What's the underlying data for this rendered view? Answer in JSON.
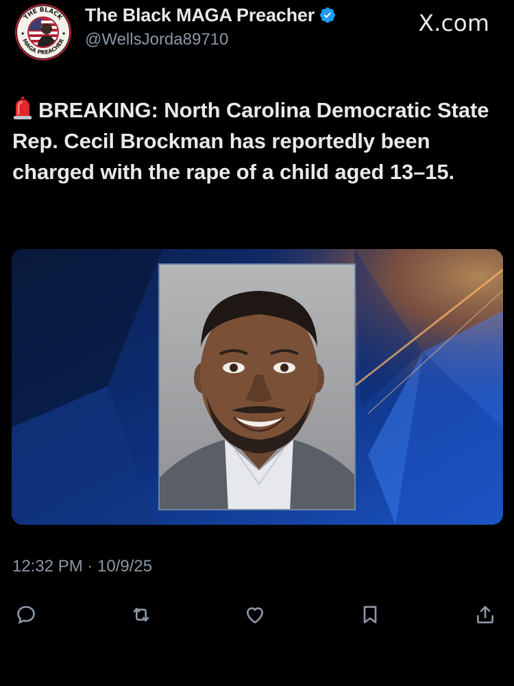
{
  "header": {
    "display_name": "The Black MAGA Preacher",
    "handle": "@WellsJorda89710",
    "brand": "X.com",
    "avatar_badge": {
      "top_text": "THE BLACK",
      "bottom_text": "MAGA PREACHER"
    },
    "verified_icon": "verified-badge-icon"
  },
  "tweet": {
    "emoji": "siren-icon",
    "text_prefix": "BREAKING:",
    "text_body": " North Carolina Democratic State Rep. Cecil Brockman has reportedly been charged with the rape of a child aged 13–15."
  },
  "timestamp": "12:32 PM · 10/9/25",
  "actions": [
    {
      "name": "reply",
      "icon": "reply-icon"
    },
    {
      "name": "repost",
      "icon": "repost-icon"
    },
    {
      "name": "like",
      "icon": "like-icon"
    },
    {
      "name": "bookmark",
      "icon": "bookmark-icon"
    },
    {
      "name": "share",
      "icon": "share-icon"
    }
  ],
  "colors": {
    "background": "#000000",
    "text_primary": "#e7e9ea",
    "text_secondary": "#8b98a5",
    "verified_blue": "#1d9bf0",
    "media_blue": "#1a4fb0",
    "media_orange": "#f0a24a"
  }
}
